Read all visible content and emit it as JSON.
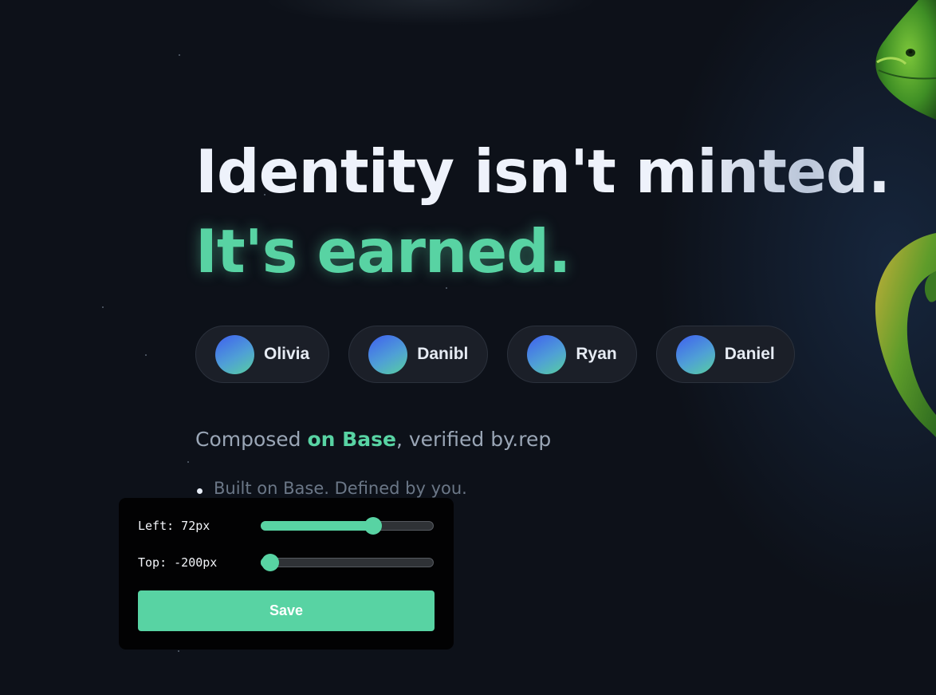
{
  "hero": {
    "headline_line1": "Identity isn't minted.",
    "headline_line2": "It's earned."
  },
  "users": [
    {
      "name": "Olivia"
    },
    {
      "name": "Danibl"
    },
    {
      "name": "Ryan"
    },
    {
      "name": "Daniel"
    }
  ],
  "tagline": {
    "prefix": "Composed ",
    "accent": "on Base",
    "suffix": ", verified by.rep"
  },
  "bullets": [
    "Built on Base. Defined by you."
  ],
  "controls": {
    "left": {
      "label": "Left: 72px",
      "level": 0.66
    },
    "top": {
      "label": "Top: -200px",
      "level": 0.0
    },
    "save_label": "Save"
  },
  "colors": {
    "accent": "#58d3a3",
    "background": "#0d1119",
    "pill_background": "#1b1f28"
  }
}
